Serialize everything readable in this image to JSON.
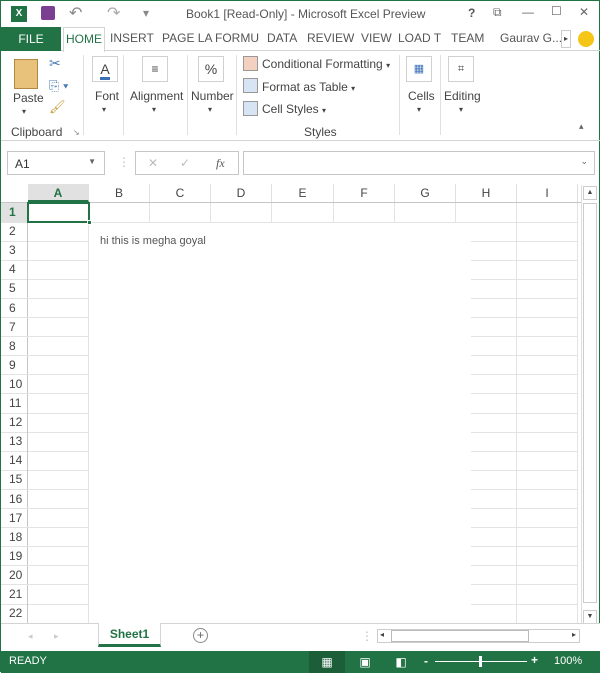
{
  "window": {
    "title": "Book1  [Read-Only] - Microsoft Excel Preview",
    "help": "?",
    "restore_icon": "⧉",
    "minimize": "—",
    "maximize": "☐",
    "close": "✕"
  },
  "quick_access": {
    "undo": "↶",
    "redo": "↷",
    "customize": "▾"
  },
  "tabs": [
    "FILE",
    "HOME",
    "INSERT",
    "PAGE LA",
    "FORMU",
    "DATA",
    "REVIEW",
    "VIEW",
    "LOAD T",
    "TEAM"
  ],
  "user": "Gaurav G...",
  "ribbon": {
    "paste": "Paste",
    "clipboard": "Clipboard",
    "font": "Font",
    "alignment": "Alignment",
    "number": "Number",
    "number_symbol": "%",
    "font_symbol": "A",
    "conditional_formatting": "Conditional Formatting",
    "format_as_table": "Format as Table",
    "cell_styles": "Cell Styles",
    "styles": "Styles",
    "cells": "Cells",
    "editing": "Editing"
  },
  "formula_bar": {
    "name_box": "A1",
    "fx": "fx",
    "value": ""
  },
  "columns": [
    "A",
    "B",
    "C",
    "D",
    "E",
    "F",
    "G",
    "H",
    "I"
  ],
  "rows": [
    "1",
    "2",
    "3",
    "4",
    "5",
    "6",
    "7",
    "8",
    "9",
    "10",
    "11",
    "12",
    "13",
    "14",
    "15",
    "16",
    "17",
    "18",
    "19",
    "20",
    "21",
    "22"
  ],
  "textbox_text": "hi this is megha goyal",
  "sheet_tab": "Sheet1",
  "status": {
    "ready": "READY",
    "zoom": "100%",
    "zoom_level": 100
  }
}
